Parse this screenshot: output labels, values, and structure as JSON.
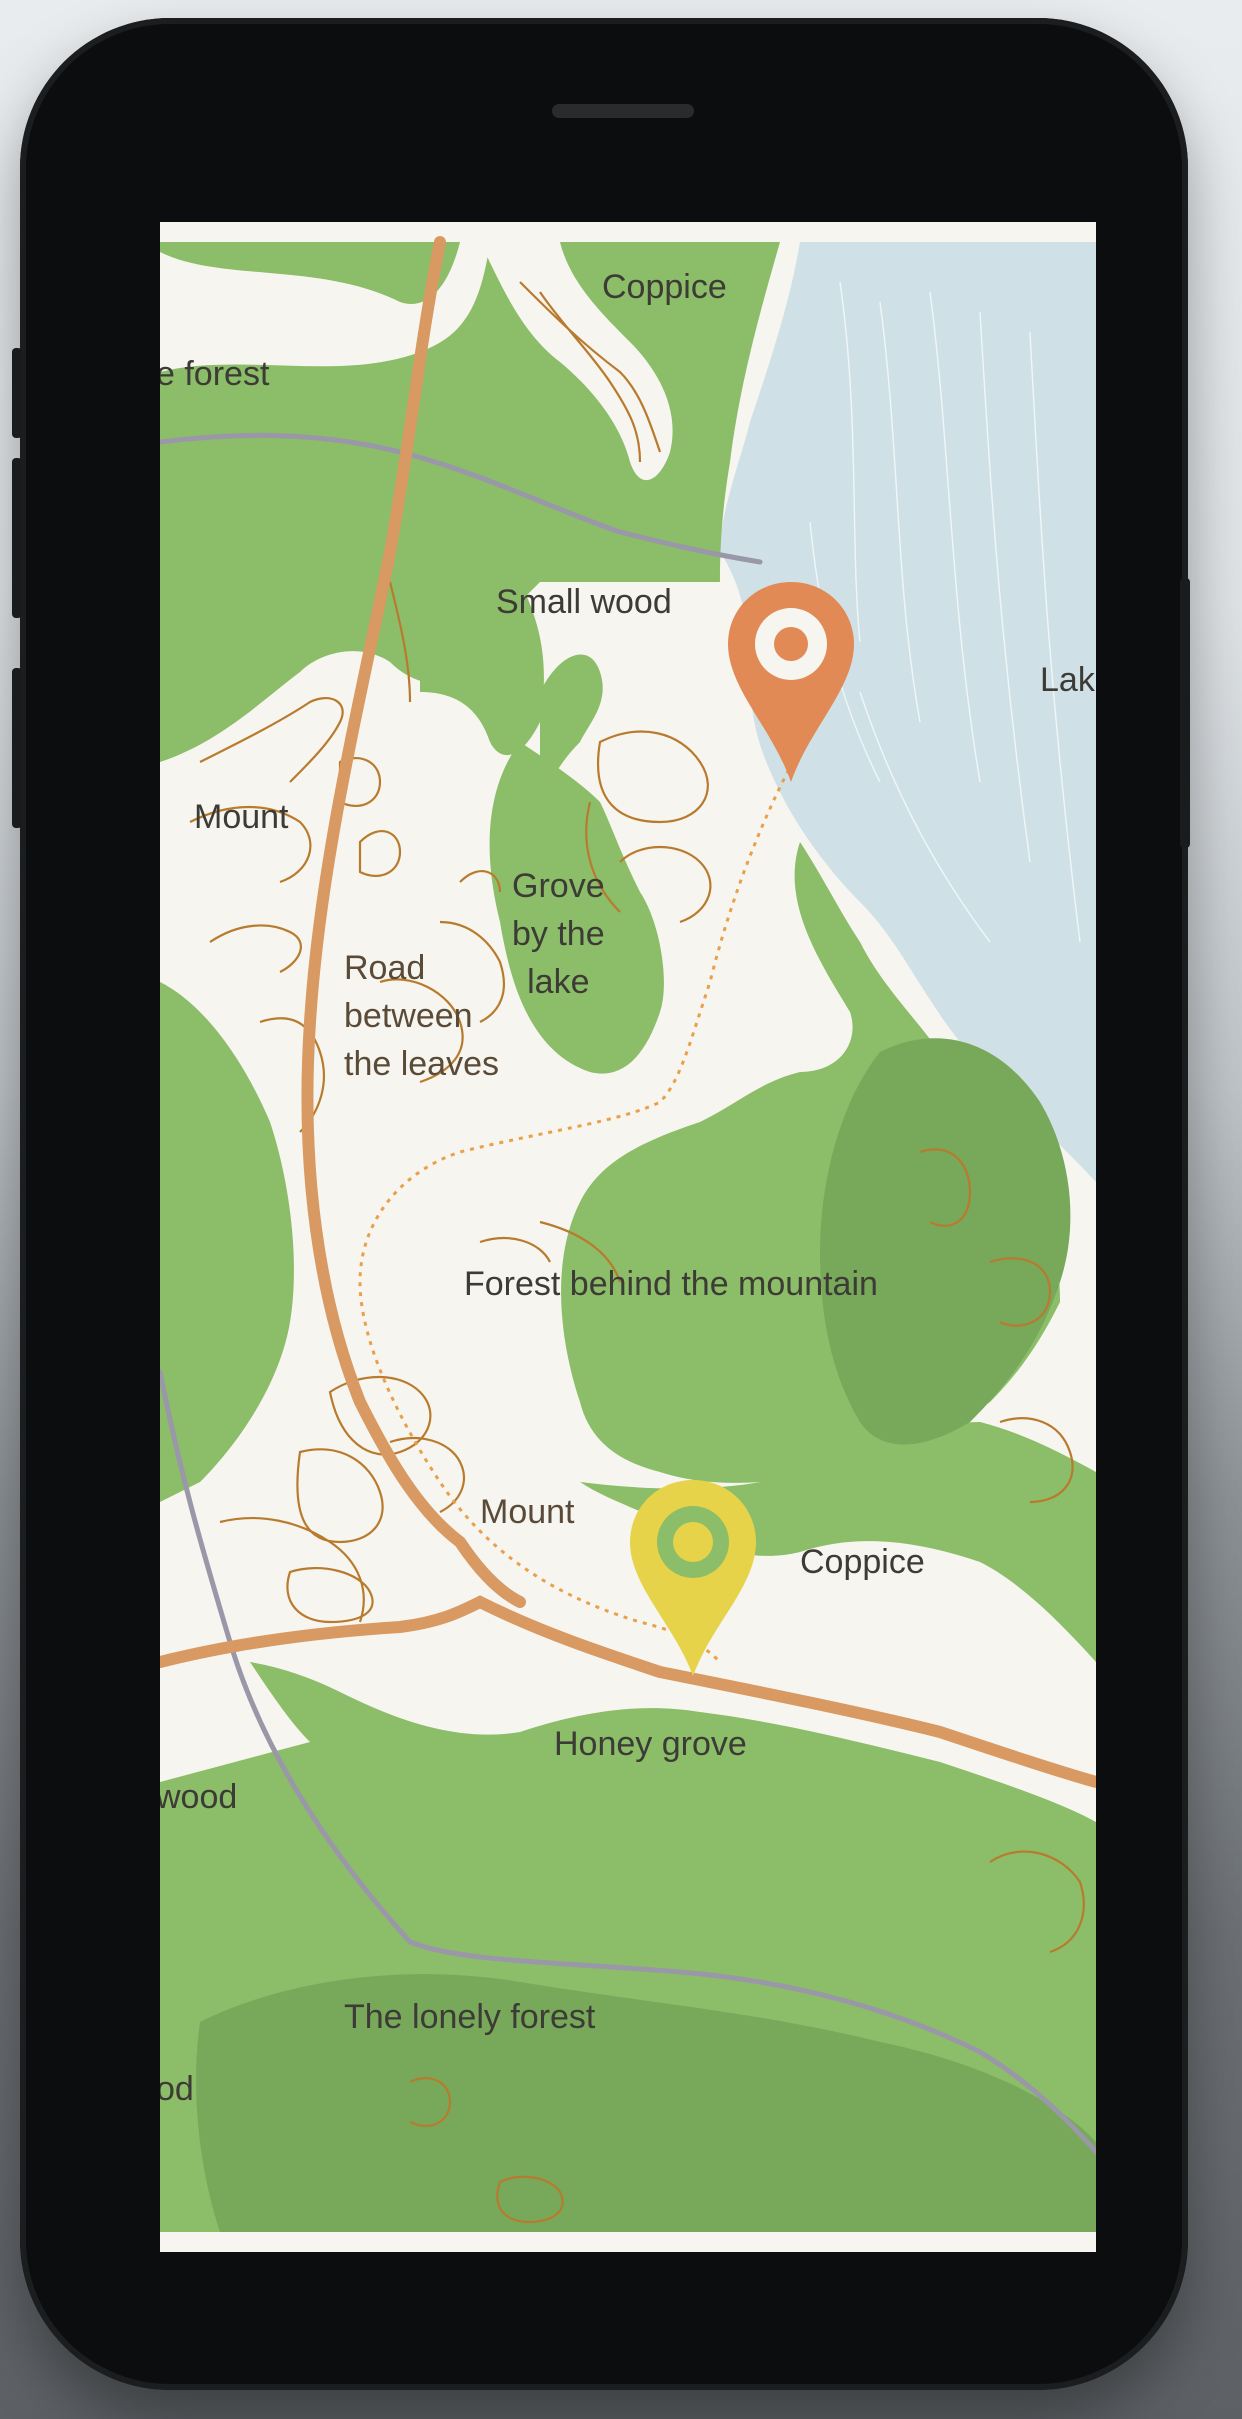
{
  "map": {
    "labels": {
      "coppice_top": "Coppice",
      "forest_left_cut": "e forest",
      "small_wood": "Small wood",
      "lake_cut": "Lak",
      "mount_upper": "Mount",
      "grove_by_the_lake": "Grove\nby the\nlake",
      "road_between_the_leaves": "Road\nbetween\nthe leaves",
      "forest_behind_the_mountain": "Forest behind the mountain",
      "mount_lower": "Mount",
      "coppice_lower": "Coppice",
      "honey_grove": "Honey grove",
      "wood_left_cut": "wood",
      "the_lonely_forest": "The lonely forest",
      "od_left_cut": "od"
    },
    "markers": {
      "origin": {
        "color": "#e18a55"
      },
      "destination": {
        "color": "#e7d34a"
      }
    },
    "colors": {
      "forest": "#8cbd68",
      "forest_dark": "#78a85a",
      "water": "#cfe1e6",
      "land": "#f7f5ef",
      "road_main": "#d89a62",
      "road_gray": "#9a97a8",
      "contour": "#b87b2e"
    }
  }
}
